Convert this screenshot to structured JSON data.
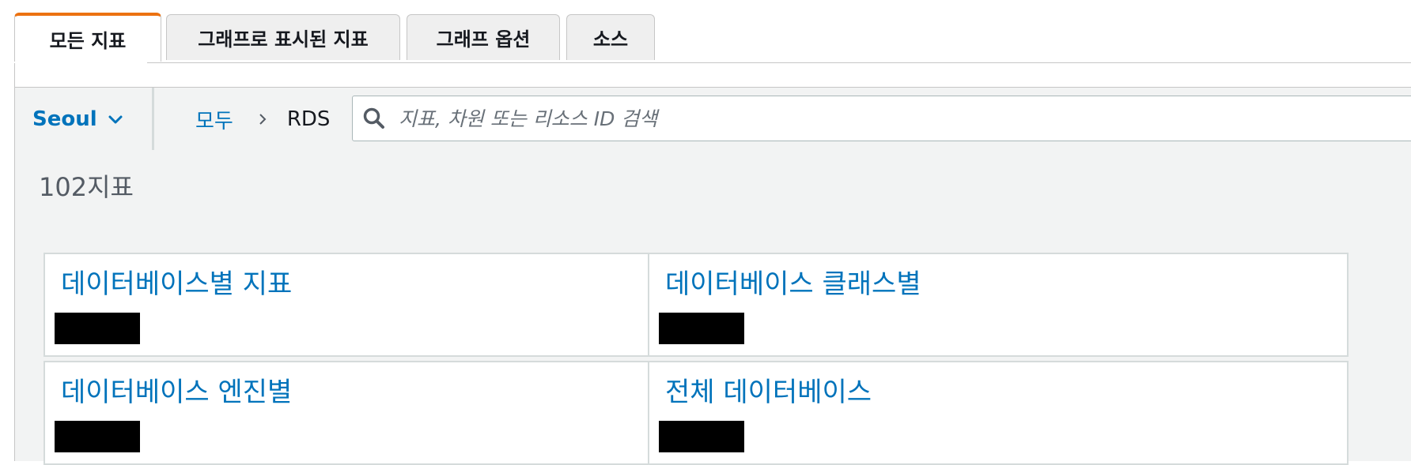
{
  "tabs": [
    {
      "label": "모든 지표",
      "active": true
    },
    {
      "label": "그래프로 표시된 지표",
      "active": false
    },
    {
      "label": "그래프 옵션",
      "active": false
    },
    {
      "label": "소스",
      "active": false
    }
  ],
  "toolbar": {
    "region": "Seoul",
    "breadcrumb": {
      "root": "모두",
      "current": "RDS"
    },
    "search_placeholder": "지표, 차원 또는 리소스 ID 검색"
  },
  "metrics": {
    "count": "102지표",
    "cards": [
      {
        "title": "데이터베이스별 지표"
      },
      {
        "title": "데이터베이스 클래스별"
      },
      {
        "title": "데이터베이스 엔진별"
      },
      {
        "title": "전체 데이터베이스"
      }
    ]
  },
  "colors": {
    "accent": "#ec7211",
    "link": "#0073bb"
  }
}
